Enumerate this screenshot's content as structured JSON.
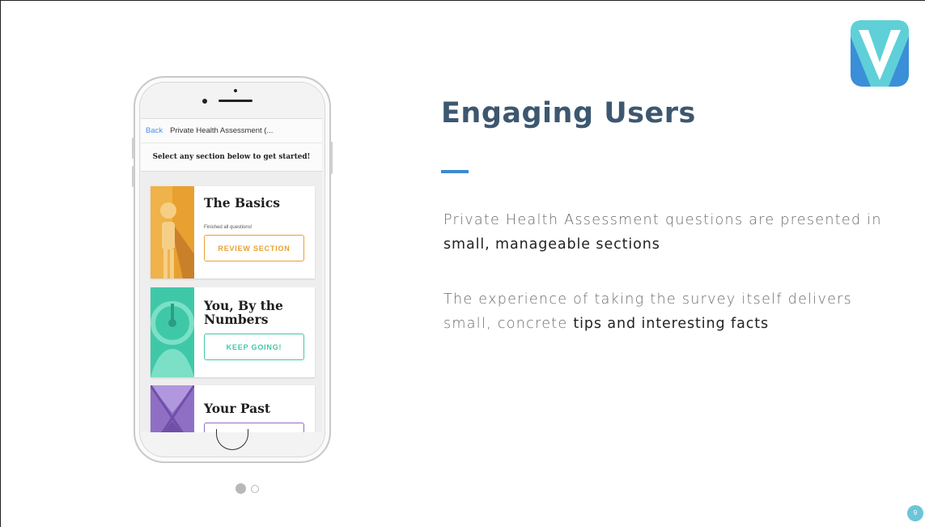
{
  "slide": {
    "title": "Engaging Users",
    "paragraphs": [
      {
        "text_before": "Private Health Assessment questions are presented in ",
        "emphasis": "small, manageable sections",
        "text_after": ""
      },
      {
        "text_before": "The experience of taking the survey itself delivers small, concrete ",
        "emphasis": "tips and interesting facts",
        "text_after": ""
      }
    ],
    "page_number": "9",
    "carousel": {
      "total": 2,
      "active_index": 0
    }
  },
  "phone_app": {
    "nav": {
      "back_label": "Back",
      "title": "Private Health Assessment (..."
    },
    "subheading": "Select any section below to get started!",
    "sections": [
      {
        "title": "The Basics",
        "status": "Finished all questions!",
        "button_label": "REVIEW SECTION",
        "color": "#e8a030",
        "icon": "person-figure-icon"
      },
      {
        "title": "You, By the Numbers",
        "status": "",
        "button_label": "KEEP GOING!",
        "color": "#3fc8a8",
        "icon": "scale-icon"
      },
      {
        "title": "Your Past",
        "status": "",
        "button_label": "",
        "color": "#8f6fc4",
        "icon": "hourglass-icon"
      }
    ]
  },
  "colors": {
    "title": "#3d5770",
    "accent_rule": "#3c8ad1",
    "logo_light": "#5fd0d8",
    "logo_dark": "#3a8fd8"
  }
}
